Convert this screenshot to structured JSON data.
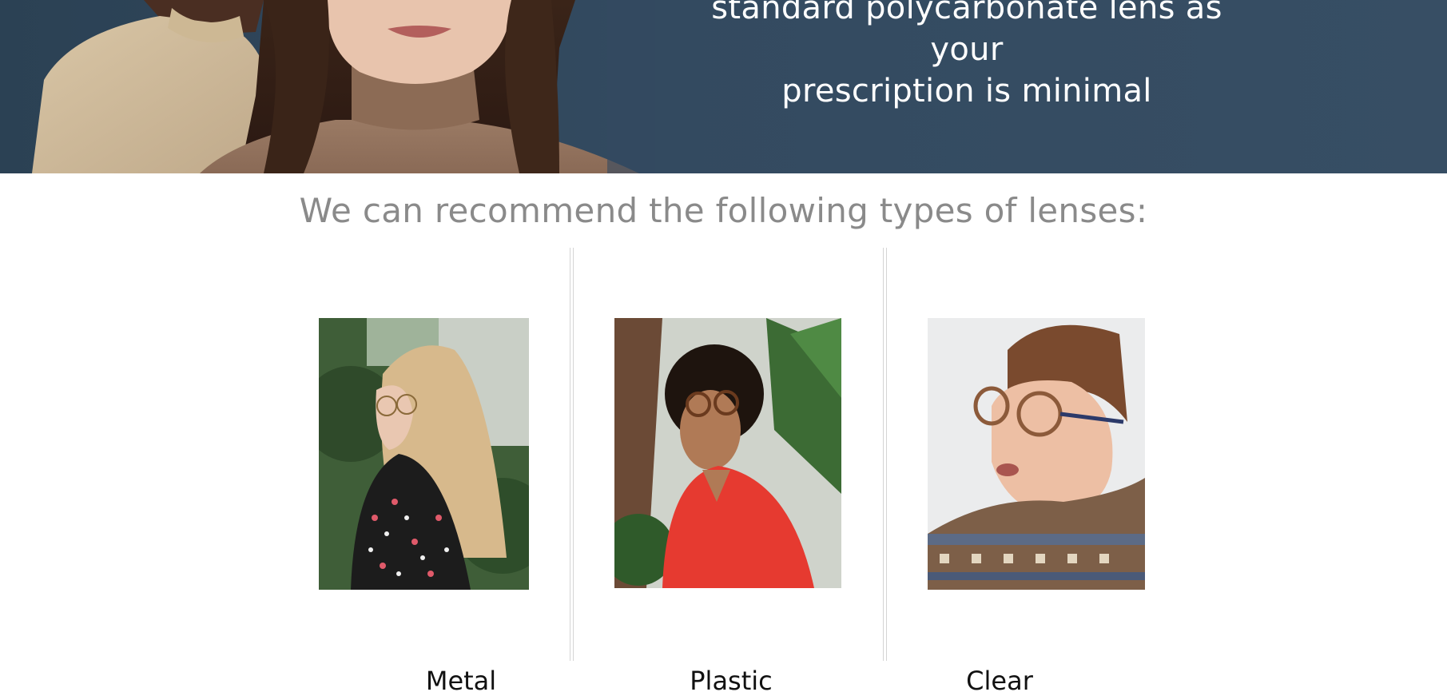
{
  "hero": {
    "line1": "standard polycarbonate lens as your",
    "line2": "prescription is minimal"
  },
  "heading": "We can recommend the following types of lenses:",
  "lenses": [
    {
      "label": "Metal"
    },
    {
      "label": "Plastic"
    },
    {
      "label": "Clear"
    }
  ],
  "colors": {
    "banner": "#334a60",
    "heading": "#8a8a8a",
    "divider": "#d5d5d5"
  }
}
